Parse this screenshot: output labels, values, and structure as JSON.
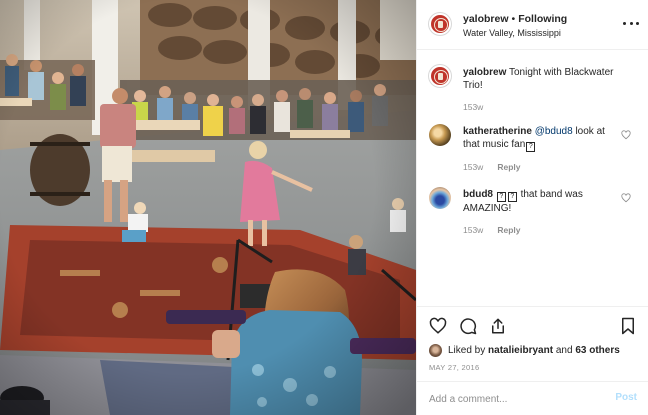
{
  "photo": {
    "description_icon": "concert-crowd-photo"
  },
  "header": {
    "username": "yalobrew",
    "separator": "•",
    "follow_state": "Following",
    "location": "Water Valley, Mississippi",
    "more_icon": "more-dots-icon"
  },
  "caption": {
    "username": "yalobrew",
    "text": "Tonight with Blackwater Trio!",
    "age": "153w"
  },
  "comments": [
    {
      "username": "katheratherine",
      "mention": "@bdud8",
      "text": "look at that music fan",
      "trailing_glyph": "?",
      "age": "153w",
      "reply_label": "Reply"
    },
    {
      "username": "bdud8",
      "leading_glyphs": [
        "?",
        "?"
      ],
      "text": "that band was AMAZING!",
      "age": "153w",
      "reply_label": "Reply"
    }
  ],
  "actions": {
    "icons": [
      "heart-icon",
      "comment-icon",
      "share-icon",
      "bookmark-icon"
    ]
  },
  "likes": {
    "prefix": "Liked by",
    "user": "natalieibryant",
    "conjunction": "and",
    "others": "63 others"
  },
  "date": "MAY 27, 2016",
  "comment_box": {
    "placeholder": "Add a comment...",
    "post_label": "Post"
  },
  "colors": {
    "text": "#262626",
    "muted": "#8e8e8e",
    "link": "#00376b",
    "post_disabled": "#b2dffc",
    "brand_badge": "#c0342a"
  }
}
